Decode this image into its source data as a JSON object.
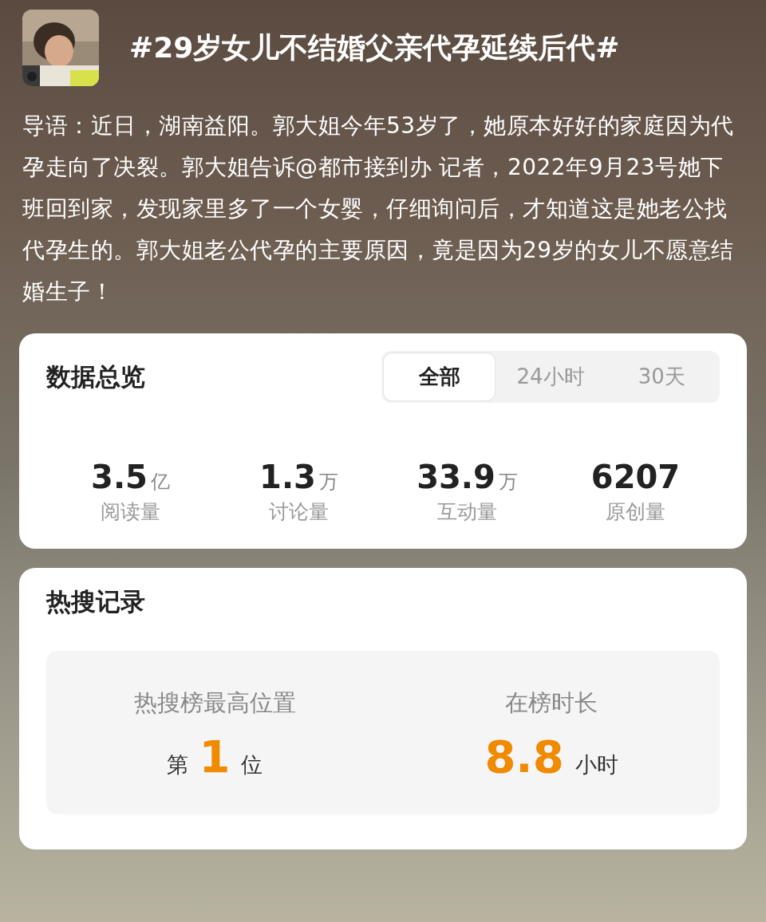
{
  "header": {
    "title": "#29岁女儿不结婚父亲代孕延续后代#"
  },
  "intro": "导语：近日，湖南益阳。郭大姐今年53岁了，她原本好好的家庭因为代孕走向了决裂。郭大姐告诉@都市接到办 记者，2022年9月23号她下班回到家，发现家里多了一个女婴，仔细询问后，才知道这是她老公找代孕生的。郭大姐老公代孕的主要原因，竟是因为29岁的女儿不愿意结婚生子！",
  "overview": {
    "title": "数据总览",
    "tabs": [
      {
        "label": "全部",
        "selected": true
      },
      {
        "label": "24小时",
        "selected": false
      },
      {
        "label": "30天",
        "selected": false
      }
    ],
    "stats": [
      {
        "value": "3.5",
        "unit": "亿",
        "label": "阅读量"
      },
      {
        "value": "1.3",
        "unit": "万",
        "label": "讨论量"
      },
      {
        "value": "33.9",
        "unit": "万",
        "label": "互动量"
      },
      {
        "value": "6207",
        "label": "原创量"
      }
    ]
  },
  "hot_search": {
    "title": "热搜记录",
    "items": [
      {
        "label": "热搜榜最高位置",
        "prefix": "第",
        "value": "1",
        "suffix": "位"
      },
      {
        "label": "在榜时长",
        "value": "8.8",
        "suffix": "小时"
      }
    ]
  }
}
